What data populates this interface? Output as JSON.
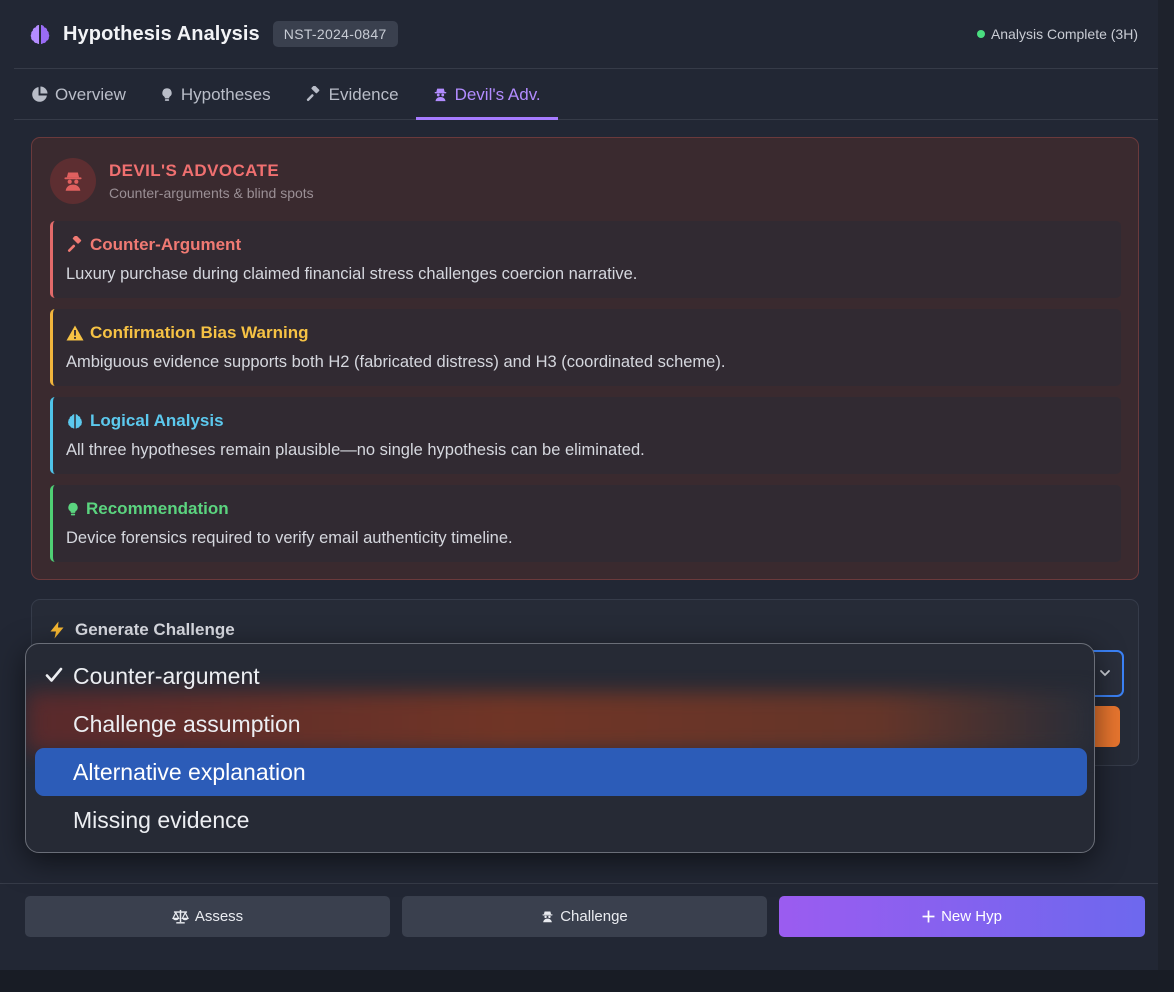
{
  "header": {
    "title": "Hypothesis Analysis",
    "case_id": "NST-2024-0847",
    "status": "Analysis Complete (3H)"
  },
  "tabs": [
    {
      "label": "Overview",
      "icon": "pie-chart-icon"
    },
    {
      "label": "Hypotheses",
      "icon": "lightbulb-icon"
    },
    {
      "label": "Evidence",
      "icon": "gavel-icon"
    },
    {
      "label": "Devil's Adv.",
      "icon": "spy-icon",
      "active": true
    }
  ],
  "devils_advocate": {
    "title": "DEVIL'S ADVOCATE",
    "subtitle": "Counter-arguments & blind spots",
    "cards": [
      {
        "title": "Counter-Argument",
        "icon": "gavel-icon",
        "text": "Luxury purchase during claimed financial stress challenges coercion narrative."
      },
      {
        "title": "Confirmation Bias Warning",
        "icon": "warning-icon",
        "text": "Ambiguous evidence supports both H2 (fabricated distress) and H3 (coordinated scheme)."
      },
      {
        "title": "Logical Analysis",
        "icon": "brain-icon",
        "text": "All three hypotheses remain plausible—no single hypothesis can be eliminated."
      },
      {
        "title": "Recommendation",
        "icon": "lightbulb-icon",
        "text": "Device forensics required to verify email authenticity timeline."
      }
    ]
  },
  "generate": {
    "title": "Generate Challenge",
    "icon": "lightning-icon"
  },
  "dropdown": {
    "selected": "Counter-argument",
    "highlighted": "Alternative explanation",
    "options": [
      "Counter-argument",
      "Challenge assumption",
      "Alternative explanation",
      "Missing evidence"
    ]
  },
  "footer": {
    "assess": "Assess",
    "challenge": "Challenge",
    "new_hyp": "New Hyp"
  },
  "colors": {
    "accent_purple": "#a67bff",
    "danger": "#f07070",
    "warning": "#f6c244",
    "info": "#5cc9ee",
    "success": "#5bd47f",
    "selection_blue": "#2c5cb8"
  }
}
